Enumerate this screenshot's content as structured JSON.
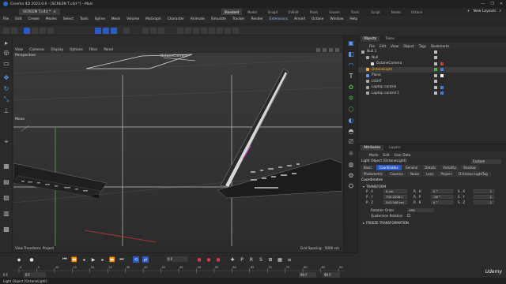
{
  "window": {
    "title": "Cinema 4D 2023.0.0 - [SCREEN T.c4d *] - Main",
    "controls": [
      "—",
      "❐",
      "✕"
    ]
  },
  "document_tab": {
    "label": "SCREEN T.c4d *"
  },
  "layouts": {
    "tabs": [
      "Standard",
      "Model",
      "Sculpt",
      "UVEdit",
      "Paint",
      "Groom",
      "Track",
      "Script",
      "Nodes",
      "Octane"
    ],
    "active": "Standard",
    "new_layouts": "New Layouts"
  },
  "menu": [
    "File",
    "Edit",
    "Create",
    "Modes",
    "Select",
    "Tools",
    "Spline",
    "Mesh",
    "Volume",
    "MoGraph",
    "Character",
    "Animate",
    "Simulate",
    "Tracker",
    "Render",
    "Extensions",
    "Arnold",
    "Octane",
    "Window",
    "Help"
  ],
  "viewport": {
    "menu": [
      "View",
      "Cameras",
      "Display",
      "Options",
      "Filter",
      "Panel"
    ],
    "name": "Perspective",
    "camera_label": "OctaneCamera",
    "move_label": "Move",
    "footer_left": "View Transform: Project",
    "footer_right": "Grid Spacing : 5000 cm"
  },
  "objects_panel": {
    "tabs": [
      "Objects",
      "Takes"
    ],
    "menu": [
      "File",
      "Edit",
      "View",
      "Object",
      "Tags",
      "Bookmarks"
    ],
    "items": [
      {
        "label": "Null.1",
        "color": "#aaaaaa",
        "indent": 0
      },
      {
        "label": "Null",
        "color": "#aaaaaa",
        "indent": 1
      },
      {
        "label": "OctaneCamera",
        "color": "#d9d9d9",
        "indent": 2
      },
      {
        "label": "OctaneLight",
        "color": "#f0b030",
        "indent": 1,
        "selected": true
      },
      {
        "label": "Plane",
        "color": "#aaaaaa",
        "indent": 1
      },
      {
        "label": "LIGHT",
        "color": "#aaaaaa",
        "indent": 1
      },
      {
        "label": "Laptop control",
        "color": "#aaaaaa",
        "indent": 1
      },
      {
        "label": "Laptop control.1",
        "color": "#aaaaaa",
        "indent": 1
      }
    ]
  },
  "attributes_panel": {
    "tabs": [
      "Attributes",
      "Layers"
    ],
    "menu": [
      "Mode",
      "Edit",
      "User Data"
    ],
    "object_label": "Light Object [OctaneLight]",
    "preset": "Custom",
    "sub_tabs": [
      "Basic",
      "Coordinates",
      "General",
      "Details",
      "Visibility",
      "Shadow",
      "Photometric",
      "Caustics",
      "Noise",
      "Lens",
      "Project",
      "O.Octane LightTag"
    ],
    "active_sub_tab": "Coordinates",
    "section": "Coordinates",
    "transform_label": "TRANSFORM",
    "rows": [
      {
        "pos": "P . X",
        "pos_val": "0 cm",
        "rot": "R . H",
        "rot_val": "0 °",
        "scale": "S . X",
        "scale_val": "1"
      },
      {
        "pos": "P . Y",
        "pos_val": "700.2208 c",
        "rot": "R . P",
        "rot_val": "-90 °",
        "scale": "S . Y",
        "scale_val": "1"
      },
      {
        "pos": "P . Z",
        "pos_val": "543.548 cm",
        "rot": "R . B",
        "rot_val": "0 °",
        "scale": "S . Z",
        "scale_val": "1"
      }
    ],
    "rotation_order_label": "Rotation Order",
    "rotation_order_value": "HPB",
    "quaternion_label": "Quaternion Rotation",
    "freeze_label": "FREEZE TRANSFORMATION"
  },
  "timeline": {
    "current_frame": "0 F",
    "start": "0 F",
    "field_left": "0 F",
    "end": "90 F",
    "end2": "90 F",
    "ticks": [
      "0",
      "5",
      "10",
      "15",
      "20",
      "25",
      "30",
      "35",
      "40",
      "45",
      "50",
      "55",
      "60",
      "65",
      "70",
      "75",
      "80",
      "85",
      "90"
    ]
  },
  "status": {
    "text": "Light Object [OctaneLight]"
  },
  "watermark": "Udemy",
  "colors": {
    "accent": "#2c5ac4",
    "bg": "#2b2b2b",
    "viewport": "#333333",
    "grid": "#bdbdbd",
    "axis_green": "#4caf50",
    "axis_red": "#c0392b"
  }
}
